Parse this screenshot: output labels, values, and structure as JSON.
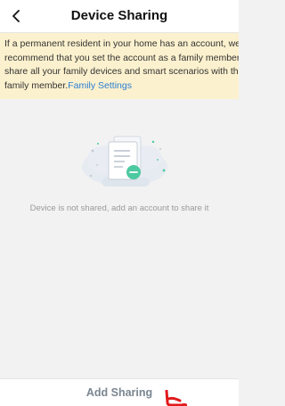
{
  "header": {
    "title": "Device Sharing",
    "back_icon": "chevron-left-icon"
  },
  "notice": {
    "lines": [
      "If a permanent resident in your home has an account, we",
      "recommend that you set the account as a family member and",
      "share all your family devices and smart scenarios with the"
    ],
    "last_line_text": "family member.",
    "link_text": "Family Settings",
    "background": "#fcf1ce",
    "link_color": "#2a7fd4"
  },
  "empty_state": {
    "illustration_icon": "shared-document-icon",
    "message": "Device is not shared, add an account to share it",
    "accent": "#4cc9a0"
  },
  "bottom": {
    "add_sharing_label": "Add Sharing",
    "annotation_mark_color": "#e0191b"
  }
}
